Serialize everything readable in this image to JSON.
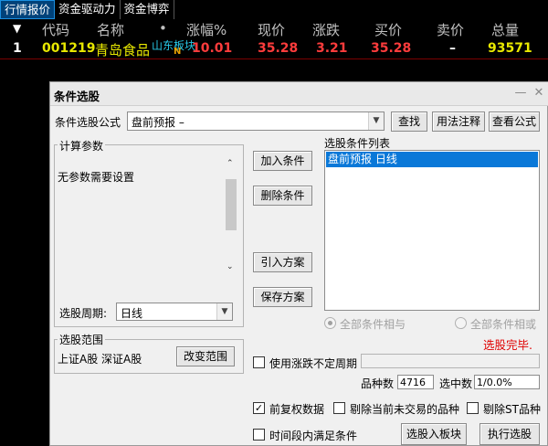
{
  "tabs": [
    "行情报价",
    "资金驱动力",
    "资金博弈"
  ],
  "quote_header": {
    "code": "代码",
    "name": "名称",
    "dot": "•",
    "change_pct": "涨幅%",
    "price": "现价",
    "change": "涨跌",
    "bid": "买价",
    "ask": "卖价",
    "volume": "总量",
    "marker": "▼"
  },
  "quote_row": {
    "index": "1",
    "code": "001219",
    "name": "青岛食品",
    "tag": "山东板块",
    "flag": "N",
    "change_pct": "10.01",
    "price": "35.28",
    "change": "3.21",
    "bid": "35.28",
    "ask": "–",
    "volume": "93571"
  },
  "dialog": {
    "title": "条件选股",
    "formula_label": "条件选股公式",
    "formula_value": "盘前预报          –",
    "find_button": "查找",
    "usage_button": "用法注释",
    "view_formula_button": "查看公式",
    "params_group": "计算参数",
    "params_text": "无参数需要设置",
    "add_condition": "加入条件",
    "delete_condition": "删除条件",
    "import_plan": "引入方案",
    "save_plan": "保存方案",
    "condition_list_label": "选股条件列表",
    "condition_item": "盘前预报   日线",
    "period_label": "选股周期:",
    "period_value": "日线",
    "radio_all_and": "全部条件相与",
    "radio_all_or": "全部条件相或",
    "status": "选股完毕.",
    "range_group": "选股范围",
    "range_text": "上证A股  深证A股",
    "change_range": "改变范围",
    "use_uncertain_period": "使用涨跌不定周期",
    "count_label": "品种数",
    "count_value": "4716",
    "selected_label": "选中数",
    "selected_value": "1/0.0%",
    "forward_adjust": "前复权数据",
    "exclude_untraded": "剔除当前未交易的品种",
    "exclude_st": "剔除ST品种",
    "time_range": "时间段内满足条件",
    "to_sector_button": "选股入板块",
    "execute_button": "执行选股"
  },
  "colors": {
    "accent": "#0a78d8",
    "up": "#ff3c3c",
    "code": "#e8e800",
    "status": "#e00000",
    "sector_tag": "#28c8e6"
  }
}
